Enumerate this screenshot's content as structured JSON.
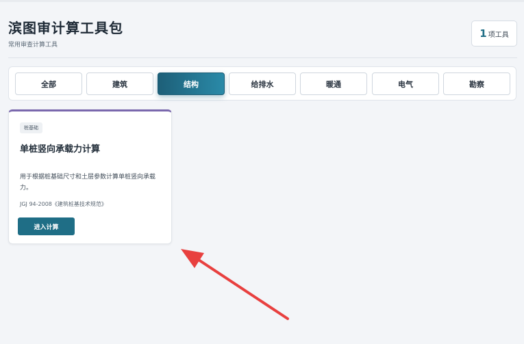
{
  "header": {
    "title": "滨图审计算工具包",
    "subtitle": "常用审查计算工具",
    "count_value": "1",
    "count_unit": "项工具"
  },
  "tabs": [
    {
      "label": "全部",
      "active": false
    },
    {
      "label": "建筑",
      "active": false
    },
    {
      "label": "结构",
      "active": true
    },
    {
      "label": "给排水",
      "active": false
    },
    {
      "label": "暖通",
      "active": false
    },
    {
      "label": "电气",
      "active": false
    },
    {
      "label": "勘察",
      "active": false
    }
  ],
  "card": {
    "tag": "桩基础",
    "title": "单桩竖向承载力计算",
    "description": "用于根据桩基础尺寸和土层参数计算单桩竖向承载力。",
    "standard": "JGJ 94-2008《建筑桩基技术规范》",
    "button_label": "进入计算",
    "accent_color": "#7a68ad"
  },
  "colors": {
    "primary": "#1f6e86",
    "annotation_arrow": "#e8403f"
  },
  "annotation": {
    "icon": "red-arrow-icon"
  }
}
